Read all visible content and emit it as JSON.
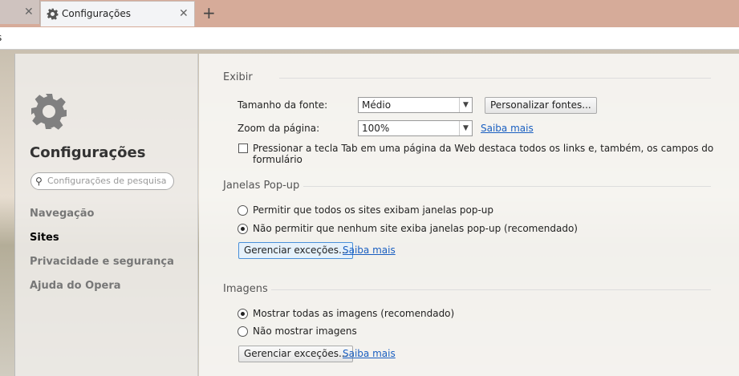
{
  "tabs": {
    "active_title": "Configurações",
    "new_tab": "+",
    "close": "✕"
  },
  "address": {
    "value": "s"
  },
  "sidebar": {
    "title": "Configurações",
    "search_placeholder": "Configurações de pesquisa",
    "items": [
      {
        "label": "Navegação"
      },
      {
        "label": "Sites"
      },
      {
        "label": "Privacidade e segurança"
      },
      {
        "label": "Ajuda do Opera"
      }
    ]
  },
  "exibir": {
    "title": "Exibir",
    "font_size_label": "Tamanho da fonte:",
    "font_size_value": "Médio",
    "customize_fonts": "Personalizar fontes...",
    "zoom_label": "Zoom da página:",
    "zoom_value": "100%",
    "learn_more": "Saiba mais",
    "tab_checkbox": "Pressionar a tecla Tab em uma página da Web destaca todos os links e, também, os campos do formulário",
    "tab_checked": false
  },
  "popups": {
    "title": "Janelas Pop-up",
    "allow": "Permitir que todos os sites exibam janelas pop-up",
    "block": "Não permitir que nenhum site exiba janelas pop-up (recomendado)",
    "selected": "block",
    "manage": "Gerenciar exceções...",
    "learn_more": "Saiba mais"
  },
  "images": {
    "title": "Imagens",
    "show": "Mostrar todas as imagens (recomendado)",
    "hide": "Não mostrar imagens",
    "selected": "show",
    "manage": "Gerenciar exceções...",
    "learn_more": "Saiba mais"
  }
}
